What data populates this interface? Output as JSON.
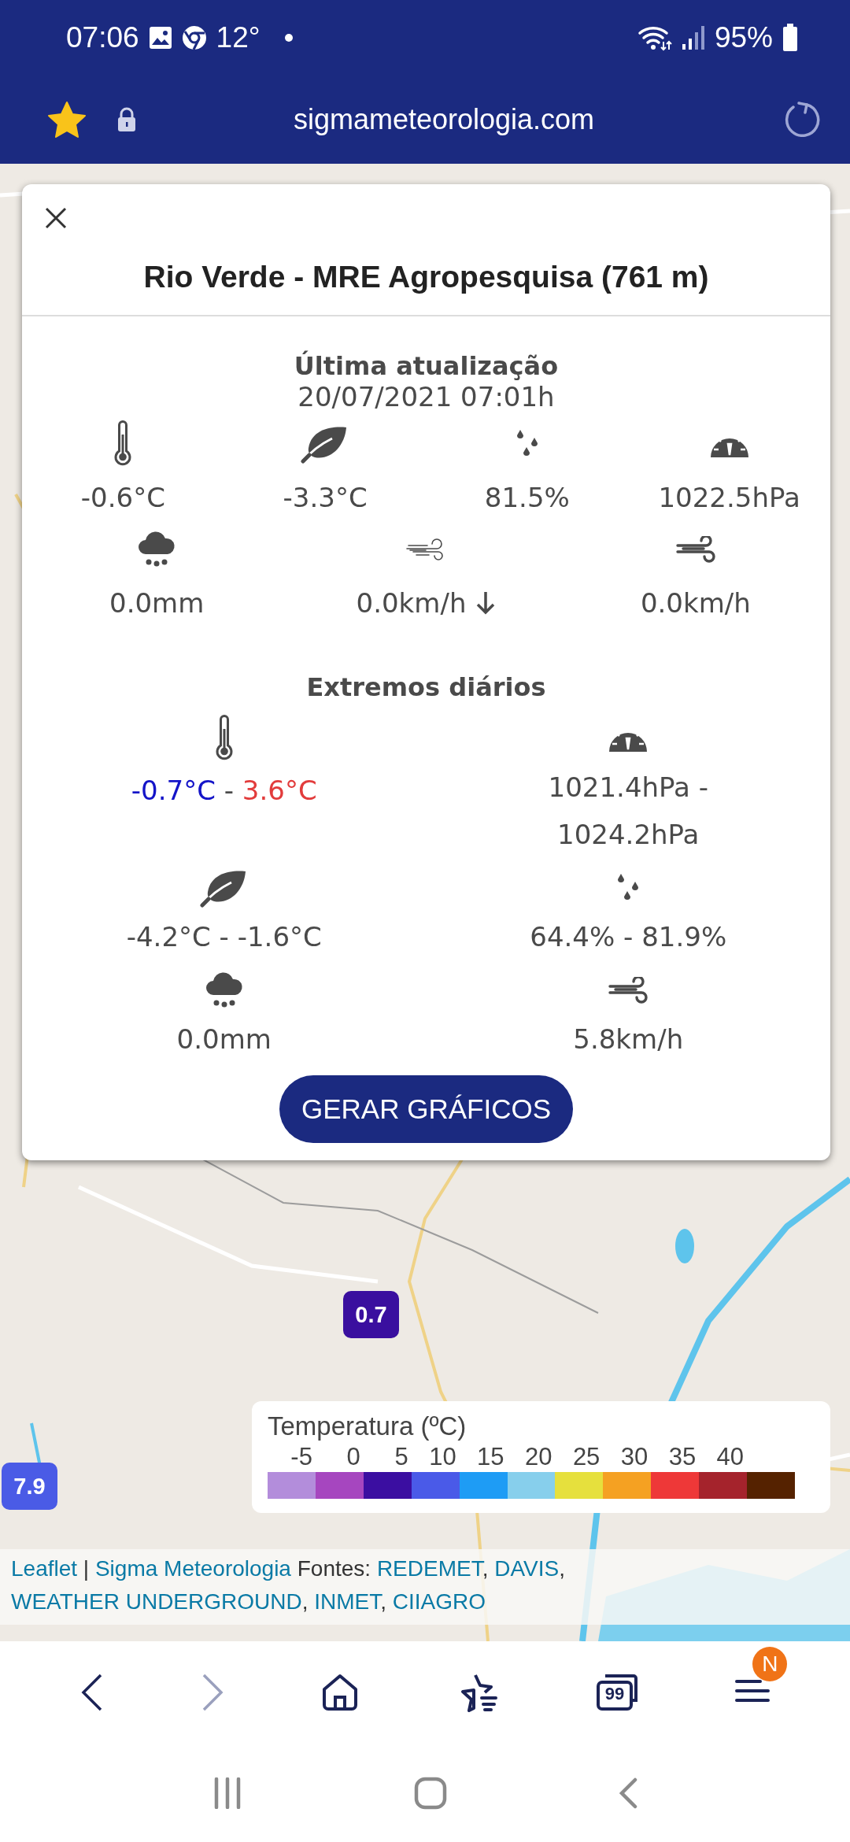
{
  "status_bar": {
    "time": "07:06",
    "temperature": "12°",
    "battery": "95%"
  },
  "address_bar": {
    "url": "sigmameteorologia.com",
    "bookmarked": true
  },
  "popup": {
    "title": "Rio Verde - MRE Agropesquisa (761 m)",
    "current": {
      "heading": "Última atualização",
      "timestamp": "20/07/2021 07:01h",
      "readings": [
        {
          "kind": "temperature",
          "value": "-0.6°C"
        },
        {
          "kind": "dew_point",
          "value": "-3.3°C"
        },
        {
          "kind": "humidity",
          "value": "81.5%"
        },
        {
          "kind": "pressure",
          "value": "1022.5hPa"
        }
      ],
      "precipitation_and_wind": [
        {
          "kind": "rain",
          "value": "0.0mm"
        },
        {
          "kind": "wind",
          "value": "0.0km/h",
          "arrow": true
        },
        {
          "kind": "gust",
          "value": "0.0km/h"
        }
      ]
    },
    "extremes": {
      "heading": "Extremos diários",
      "items": [
        {
          "kind": "temperature",
          "parts": [
            {
              "text": "-0.7°C",
              "color": "#1414c8"
            },
            {
              "text": " - ",
              "color": "#4a4a4a"
            },
            {
              "text": "3.6°C",
              "color": "#e23c3c"
            }
          ]
        },
        {
          "kind": "pressure",
          "lines": [
            "1021.4hPa -",
            "1024.2hPa"
          ]
        },
        {
          "kind": "dew_point",
          "lines": [
            "-4.2°C - -1.6°C"
          ]
        },
        {
          "kind": "humidity",
          "lines": [
            "64.4% - 81.9%"
          ]
        },
        {
          "kind": "rain",
          "lines": [
            "0.0mm"
          ]
        },
        {
          "kind": "gust",
          "lines": [
            "5.8km/h"
          ]
        }
      ]
    },
    "button": "GERAR GRÁFICOS"
  },
  "markers": [
    {
      "value": "0.7",
      "color": "#3a0f9f"
    },
    {
      "value": "7.9",
      "color": "#4a5be6"
    }
  ],
  "legend": {
    "title": "Temperatura (ºC)",
    "ticks": [
      "-5",
      "0",
      "5",
      "10",
      "15",
      "20",
      "25",
      "30",
      "35",
      "40"
    ],
    "swatches": [
      {
        "color": "#b38ddb"
      },
      {
        "color": "#a646bf"
      },
      {
        "color": "#3b0ea1"
      },
      {
        "color": "#4a5ae8"
      },
      {
        "color": "#1e9cf5"
      },
      {
        "color": "#87cfec"
      },
      {
        "color": "#e6e03d"
      },
      {
        "color": "#f5a122"
      },
      {
        "color": "#ee3838"
      },
      {
        "color": "#a5232c"
      },
      {
        "color": "#552200"
      }
    ]
  },
  "attribution": [
    {
      "kind": "link",
      "text": "Leaflet"
    },
    {
      "kind": "plain",
      "text": " | "
    },
    {
      "kind": "link",
      "text": "Sigma Meteorologia"
    },
    {
      "kind": "plain",
      "text": " Fontes: "
    },
    {
      "kind": "link",
      "text": "REDEMET"
    },
    {
      "kind": "plain",
      "text": ", "
    },
    {
      "kind": "link",
      "text": "DAVIS"
    },
    {
      "kind": "plain",
      "text": ", "
    },
    {
      "kind": "link",
      "text": "WEATHER UNDERGROUND"
    },
    {
      "kind": "plain",
      "text": ", "
    },
    {
      "kind": "link",
      "text": "INMET"
    },
    {
      "kind": "plain",
      "text": ", "
    },
    {
      "kind": "link",
      "text": "CIIAGRO"
    }
  ],
  "browser_nav": {
    "back_enabled": true,
    "forward_enabled": false,
    "tab_count": "99",
    "menu_badge": "N"
  }
}
